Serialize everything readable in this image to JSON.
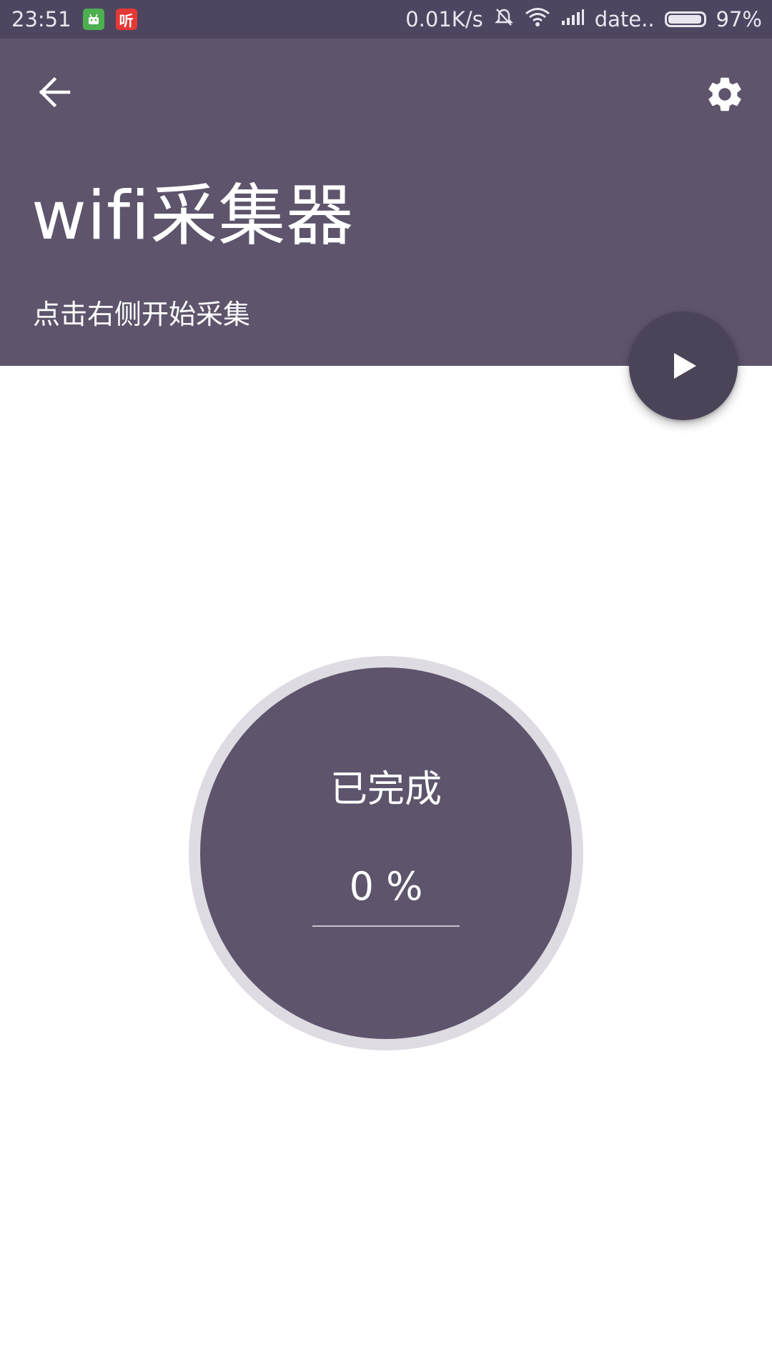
{
  "status_bar": {
    "time": "23:51",
    "notification_icons": [
      "android-icon",
      "listen-app-icon"
    ],
    "listen_app_glyph": "听",
    "net_speed": "0.01K/s",
    "carrier": "date..",
    "battery_percent": "97%",
    "battery_level": 0.97
  },
  "app_bar": {
    "title": "wifi采集器",
    "subtitle": "点击右侧开始采集",
    "back_icon": "arrow-left-icon",
    "settings_icon": "gear-icon"
  },
  "fab": {
    "icon": "play-icon"
  },
  "progress": {
    "label": "已完成",
    "value": "0 %",
    "fraction": 0
  },
  "colors": {
    "status_bar": "#4e4660",
    "app_bar": "#5e546c",
    "fab": "#4b4358",
    "ring": "#dedbe2",
    "core": "#5e546c"
  }
}
